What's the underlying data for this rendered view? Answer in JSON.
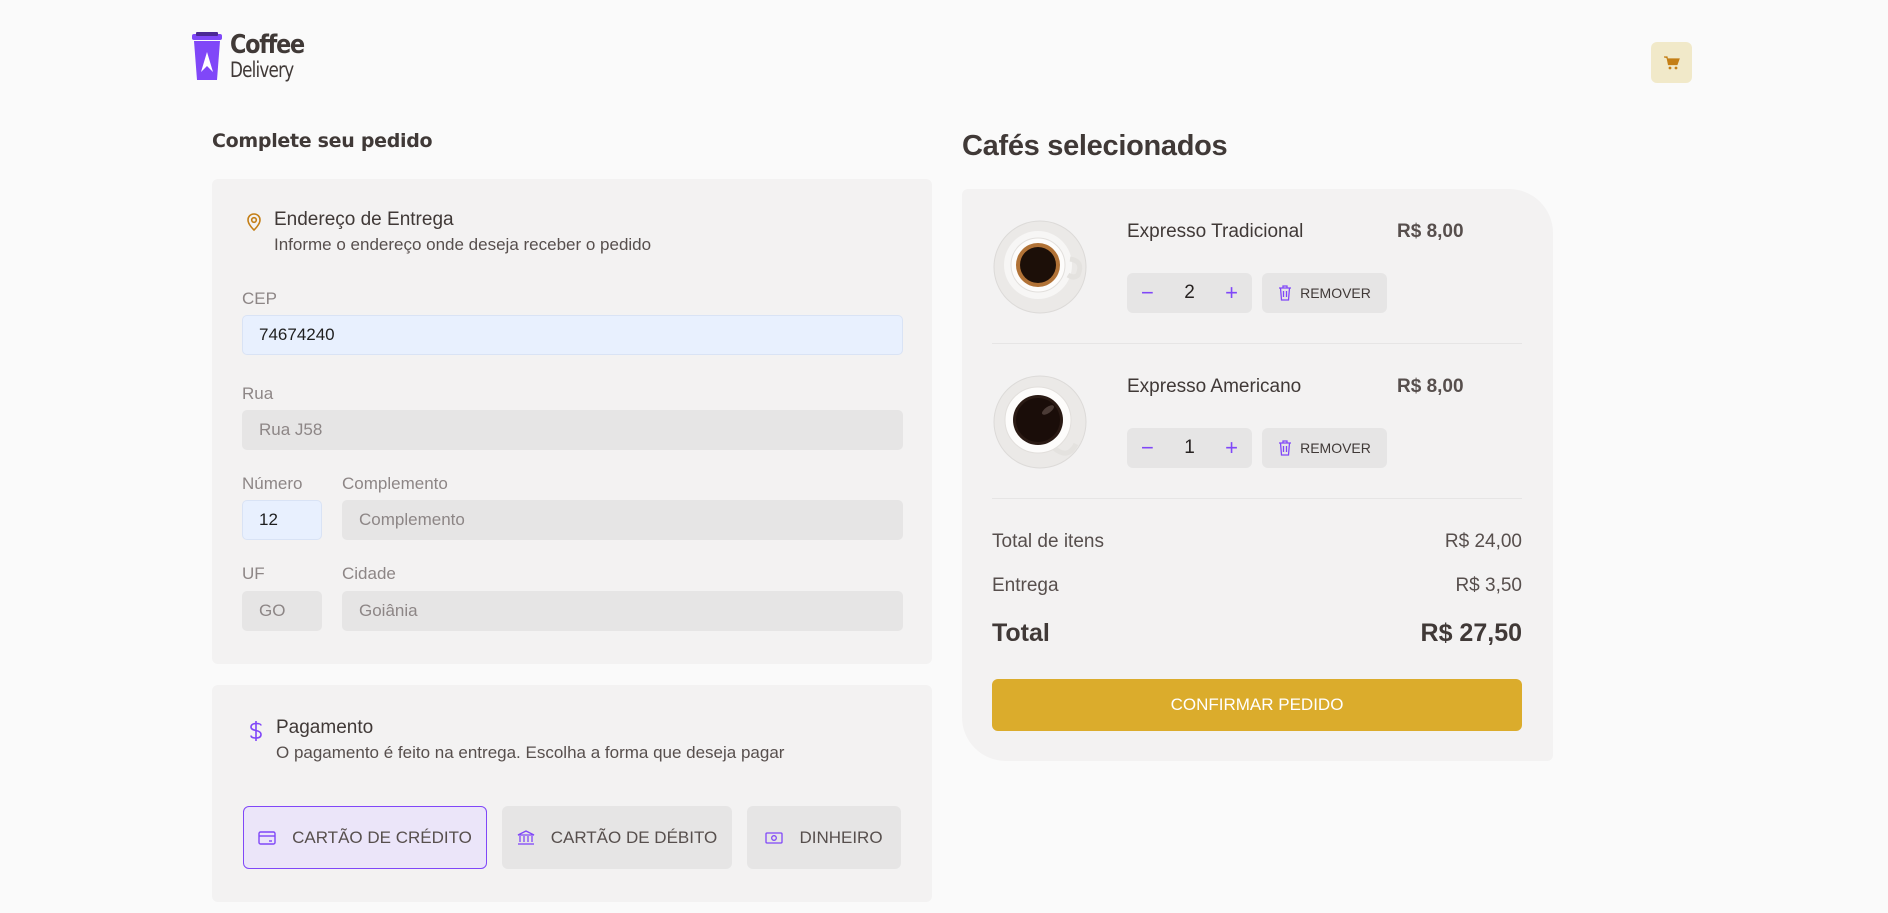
{
  "brand": {
    "line1": "Coffee",
    "line2": "Delivery",
    "logo_icon": "coffee-cup-logo",
    "purple": "#8047f8",
    "yellow": "#dbac2c"
  },
  "header": {
    "cart_icon": "cart-icon"
  },
  "order": {
    "title": "Complete seu pedido",
    "address": {
      "icon": "map-pin-icon",
      "title": "Endereço de Entrega",
      "subtitle": "Informe o endereço onde deseja receber o pedido",
      "fields": {
        "cep": {
          "label": "CEP",
          "value": "74674240"
        },
        "rua": {
          "label": "Rua",
          "value": "Rua J58"
        },
        "numero": {
          "label": "Número",
          "value": "12"
        },
        "complemento": {
          "label": "Complemento",
          "value": "",
          "placeholder": "Complemento"
        },
        "uf": {
          "label": "UF",
          "value": "GO"
        },
        "cidade": {
          "label": "Cidade",
          "value": "Goiânia"
        }
      }
    },
    "payment": {
      "icon": "dollar-icon",
      "title": "Pagamento",
      "subtitle": "O pagamento é feito na entrega. Escolha a forma que deseja pagar",
      "options": [
        {
          "label": "CARTÃO DE CRÉDITO",
          "icon": "credit-card-icon",
          "selected": true
        },
        {
          "label": "CARTÃO DE DÉBITO",
          "icon": "bank-icon",
          "selected": false
        },
        {
          "label": "DINHEIRO",
          "icon": "money-icon",
          "selected": false
        }
      ]
    }
  },
  "cart": {
    "title": "Cafés selecionados",
    "items": [
      {
        "name": "Expresso Tradicional",
        "price": "R$ 8,00",
        "quantity": "2",
        "remove_label": "REMOVER"
      },
      {
        "name": "Expresso Americano",
        "price": "R$ 8,00",
        "quantity": "1",
        "remove_label": "REMOVER"
      }
    ],
    "totals": {
      "items_label": "Total de itens",
      "items_value": "R$ 24,00",
      "delivery_label": "Entrega",
      "delivery_value": "R$ 3,50",
      "total_label": "Total",
      "total_value": "R$ 27,50"
    },
    "confirm_label": "CONFIRMAR PEDIDO"
  }
}
